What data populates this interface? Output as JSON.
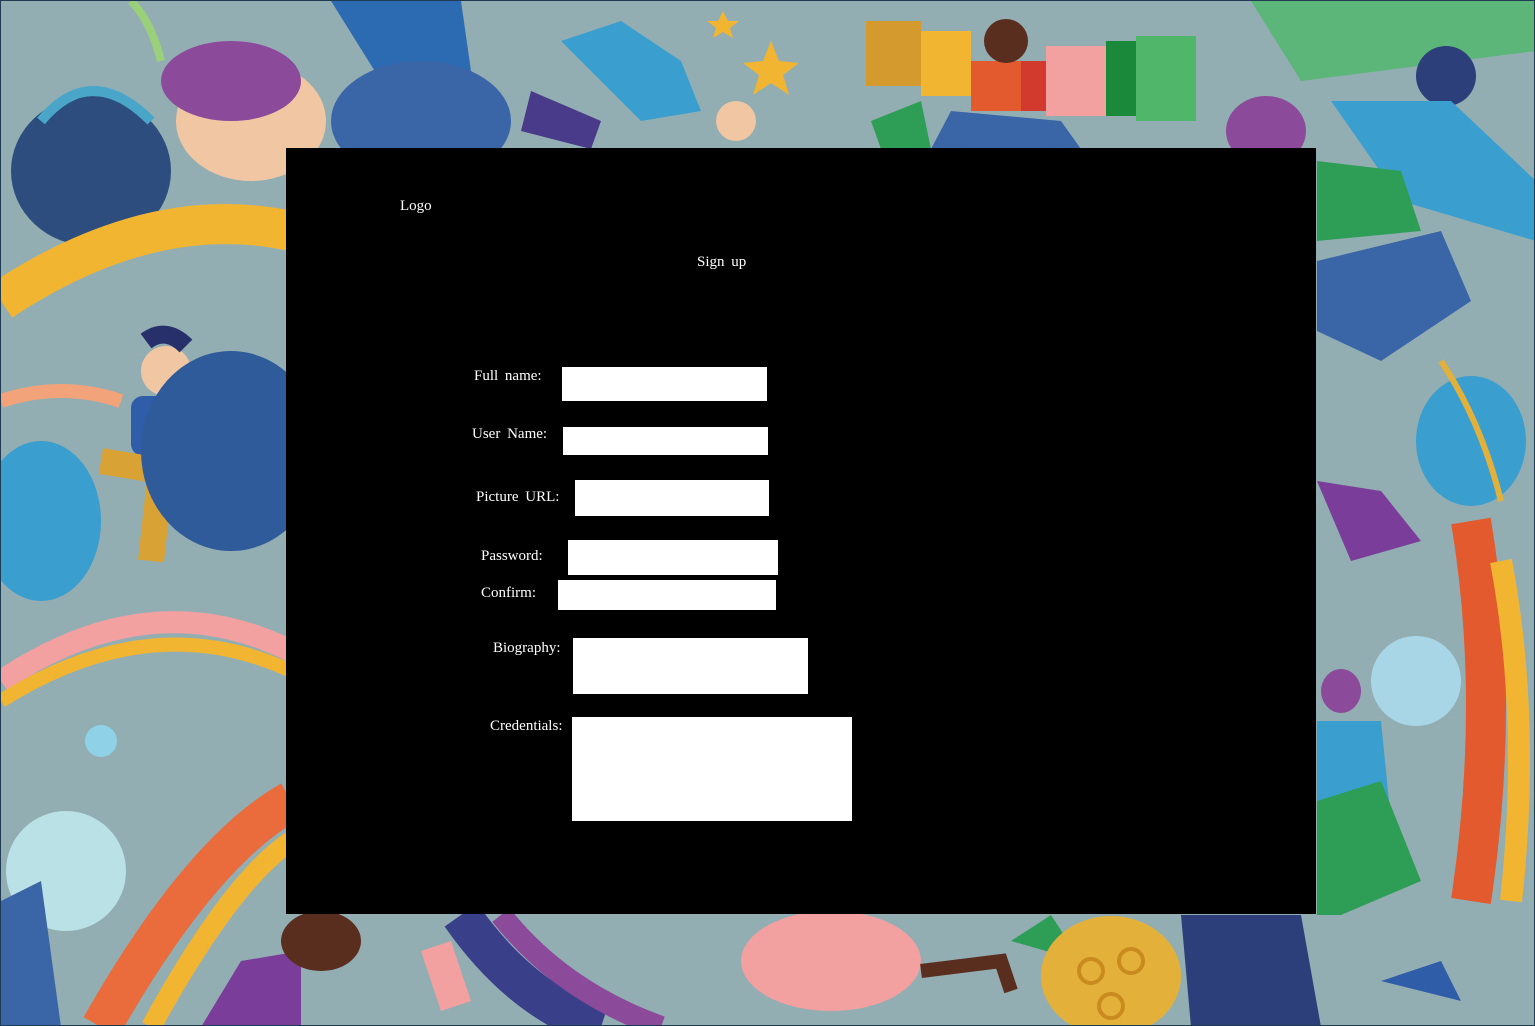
{
  "panel": {
    "logo_text": "Logo",
    "title": "Sign up"
  },
  "form": {
    "full_name_label": "Full name:",
    "full_name_value": "",
    "user_name_label": "User Name:",
    "user_name_value": "",
    "picture_url_label": "Picture URL:",
    "picture_url_value": "",
    "password_label": "Password:",
    "password_value": "",
    "confirm_label": "Confirm:",
    "confirm_value": "",
    "biography_label": "Biography:",
    "biography_value": "",
    "credentials_label": "Credentials:",
    "credentials_value": ""
  },
  "colors": {
    "panel_background": "#000000",
    "field_background": "#ffffff",
    "label_text": "#ffffff",
    "page_background": "#8fa9ae"
  },
  "background_illustration": {
    "description_icon": "people-celebration-illustration"
  }
}
